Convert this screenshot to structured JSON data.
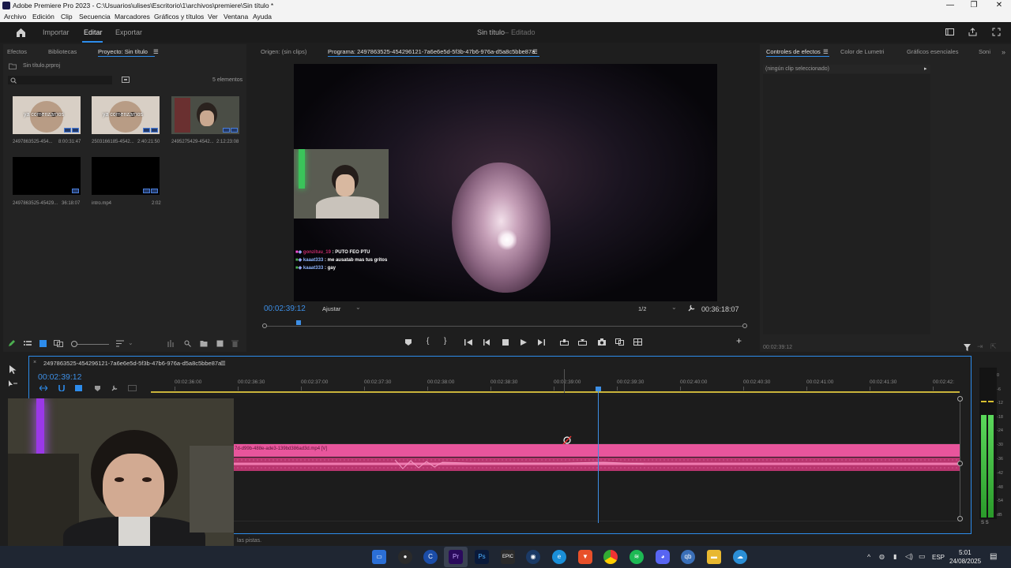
{
  "window": {
    "title": "Adobe Premiere Pro 2023 - C:\\Usuarios\\ulises\\Escritorio\\1\\archivos\\premiere\\Sin título *",
    "minimize": "—",
    "maximize": "❐",
    "close": "✕"
  },
  "menu": [
    "Archivo",
    "Edición",
    "Clip",
    "Secuencia",
    "Marcadores",
    "Gráficos y títulos",
    "Ver",
    "Ventana",
    "Ayuda"
  ],
  "workspace": {
    "tabs": [
      "Importar",
      "Editar",
      "Exportar"
    ],
    "active_tab": "Editar",
    "project_name": "Sin título",
    "project_status": "Editado"
  },
  "project_panel": {
    "tabs": [
      "Efectos",
      "Bibliotecas",
      "Proyecto: Sin título"
    ],
    "file": "Sin título.prproj",
    "item_count": "5 elementos",
    "items": [
      {
        "name": "2497863525-454...",
        "duration": "8:00:31:47",
        "overlay": "ya comenzamos"
      },
      {
        "name": "2503166185-4542...",
        "duration": "2:40:21:50",
        "overlay": "ya comenzamos"
      },
      {
        "name": "2495275429-4542...",
        "duration": "2:12:23:08",
        "overlay": ""
      },
      {
        "name": "2497863525-45429...",
        "duration": "36:18:07",
        "overlay": ""
      },
      {
        "name": "intro.mp4",
        "duration": "2:02",
        "overlay": ""
      }
    ]
  },
  "program_monitor": {
    "source_tab": "Origen: (sin clips)",
    "program_tab": "Programa: 2497863525-454296121-7a6e6e5d-5f3b-47b6-976a-d5a8c5bbe87a",
    "timecode": "00:02:39:12",
    "fit": "Ajustar",
    "resolution": "1/2",
    "duration": "00:36:18:07",
    "playhead_fraction": 0.07,
    "chat": [
      {
        "user": "gonzituu_19",
        "message": ": PUTO FEO PTU"
      },
      {
        "user": "kaaat333",
        "message": ": me ausatab mas tus gritos"
      },
      {
        "user": "kaaat333",
        "message": ": gay"
      }
    ]
  },
  "effects_panel": {
    "tabs": [
      "Controles de efectos",
      "Color de Lumetri",
      "Gráficos esenciales",
      "Soni"
    ],
    "empty_state": "(ningún clip seleccionado)",
    "timecode": "00:02:39:12"
  },
  "timeline": {
    "sequence_name": "2497863525-454296121-7a6e6e5d-5f3b-47b6-976a-d5a8c5bbe87a",
    "timecode": "00:02:39:12",
    "ticks": [
      "00:02:36:00",
      "00:02:36:30",
      "00:02:37:00",
      "00:02:37:30",
      "00:02:38:00",
      "00:02:38:30",
      "00:02:39:00",
      "00:02:39:30",
      "00:02:40:00",
      "00:02:40:30",
      "00:02:41:00",
      "00:02:41:30",
      "00:02:42:"
    ],
    "clip_label": "7d-d99b-488e-ade3-139bd386ad3d.mp4 [V]",
    "status": "las pistas.",
    "clip_color": "#e8559c"
  },
  "audio_meter": {
    "labels": [
      "0",
      "-6",
      "-12",
      "-18",
      "-24",
      "-30",
      "-36",
      "-42",
      "-48",
      "-54",
      "dB"
    ],
    "footer": "S S"
  },
  "taskbar": {
    "icons": [
      "files-icon",
      "obs-icon",
      "ccleaner-icon",
      "premiere-icon",
      "photoshop-icon",
      "epic-icon",
      "steam-icon",
      "edge-icon",
      "brave-icon",
      "chrome-icon",
      "spotify-icon",
      "discord-icon",
      "qbittorrent-icon",
      "explorer-icon",
      "app-icon"
    ],
    "labels": {
      "premiere": "Pr",
      "photoshop": "Ps",
      "epic": "EPIC",
      "qb": "qb"
    },
    "language": "ESP",
    "time": "5:01",
    "date": "24/08/2025"
  }
}
